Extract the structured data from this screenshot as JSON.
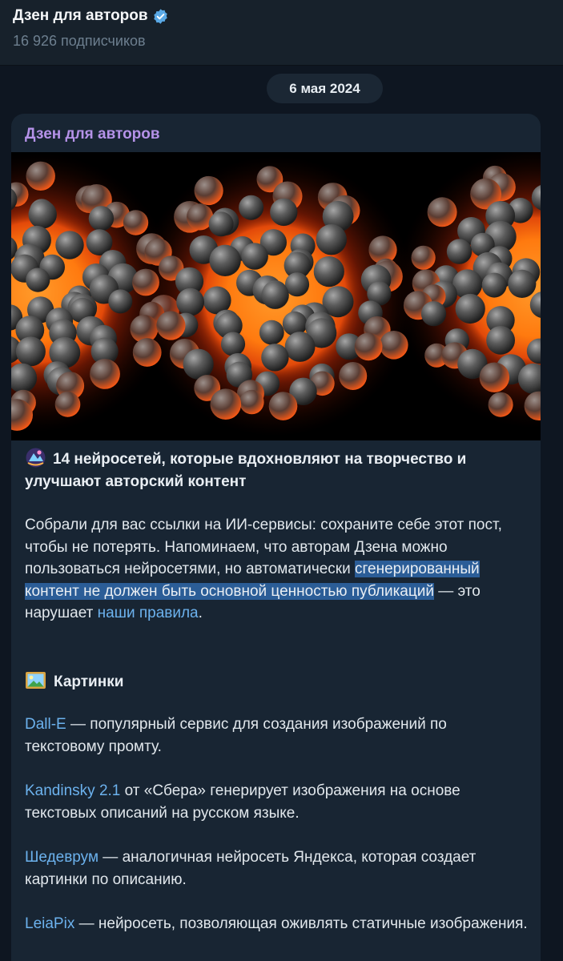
{
  "header": {
    "title": "Дзен для авторов",
    "subscribers": "16 926 подписчиков"
  },
  "date_badge": "6 мая 2024",
  "post": {
    "author": "Дзен для авторов",
    "heading": "14 нейросетей, которые вдохновляют на творчество и улучшают авторский контент",
    "intro_plain": "Собрали для вас ссылки на ИИ-сервисы: сохраните себе этот пост, чтобы не потерять. Напоминаем, что авторам Дзена можно пользоваться нейросетями, но автоматически ",
    "intro_selected": "сгенерированный контент не должен быть основной ценностью публикаций",
    "intro_after": " — это нарушает ",
    "intro_link": "наши правила",
    "intro_end": ".",
    "section_title": "Картинки",
    "items": [
      {
        "link": "Dall-E",
        "text": " — популярный сервис для создания изображений по текстовому промту."
      },
      {
        "link": "Kandinsky 2.1",
        "text": " от «Сбера» генерирует изображения на основе текстовых описаний на русском языке."
      },
      {
        "link": "Шедеврум",
        "text": " — аналогичная нейросеть Яндекса, которая создает картинки по описанию."
      },
      {
        "link": "LeiaPix",
        "text": " — нейросеть, позволяющая оживлять статичные изображения."
      }
    ]
  },
  "colors": {
    "background": "#0e1621",
    "header": "#17212b",
    "bubble": "#182533",
    "author": "#b592e8",
    "link": "#6cb2ee",
    "selection": "#2b5d97",
    "verified": "#5aa9e6"
  },
  "icons": {
    "verified": "verified-badge-icon",
    "heading_emoji": "sparkle-sticker-icon",
    "section_emoji": "framed-picture-icon"
  }
}
